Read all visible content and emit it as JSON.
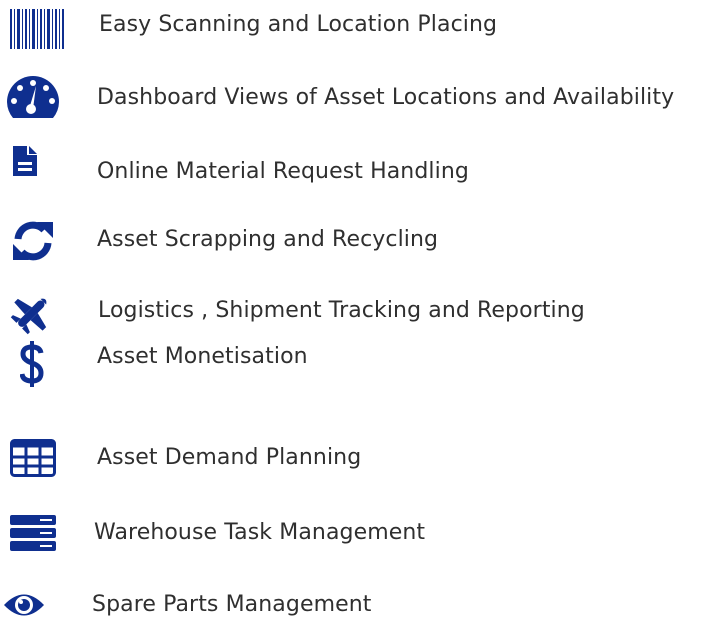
{
  "accent_color": "#0f2f8f",
  "features": [
    {
      "icon": "barcode-icon",
      "label": "Easy Scanning and Location Placing"
    },
    {
      "icon": "dashboard-gauge-icon",
      "label": "Dashboard Views of Asset Locations and Availability"
    },
    {
      "icon": "document-icon",
      "label": "Online Material Request Handling"
    },
    {
      "icon": "refresh-icon",
      "label": "Asset Scrapping and Recycling"
    },
    {
      "icon": "airplane-icon",
      "label": "Logistics , Shipment Tracking and Reporting"
    },
    {
      "icon": "dollar-icon",
      "label": "Asset Monetisation"
    },
    {
      "icon": "table-grid-icon",
      "label": "Asset Demand Planning"
    },
    {
      "icon": "server-stack-icon",
      "label": "Warehouse Task Management"
    },
    {
      "icon": "eye-icon",
      "label": "Spare Parts Management"
    }
  ]
}
